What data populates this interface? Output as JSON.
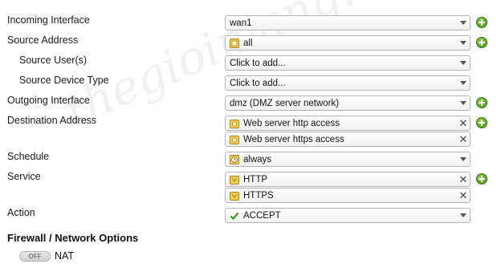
{
  "labels": {
    "incoming_interface": "Incoming Interface",
    "source_address": "Source Address",
    "source_users": "Source User(s)",
    "source_device_type": "Source Device Type",
    "outgoing_interface": "Outgoing Interface",
    "destination_address": "Destination Address",
    "schedule": "Schedule",
    "service": "Service",
    "action": "Action"
  },
  "fields": {
    "incoming_interface": "wan1",
    "source_address": "all",
    "source_users": "Click to add...",
    "source_device_type": "Click to add...",
    "outgoing_interface": "dmz (DMZ server network)",
    "destination_addresses": [
      "Web server http access",
      "Web server https access"
    ],
    "schedule": "always",
    "services": [
      "HTTP",
      "HTTPS"
    ],
    "action": "ACCEPT"
  },
  "options": {
    "section_title": "Firewall / Network Options",
    "nat_toggle_state": "OFF",
    "nat_label": "NAT"
  },
  "watermark": "thegioimang.vn",
  "icons": {
    "add": "plus-circle-icon",
    "address": "address-object-icon",
    "schedule": "clock-icon",
    "service": "service-icon",
    "action": "checkmark-icon"
  },
  "colors": {
    "add_button": "#3f8f12",
    "accept_check": "#2e8b1e",
    "object_icon": "#e8b320"
  }
}
